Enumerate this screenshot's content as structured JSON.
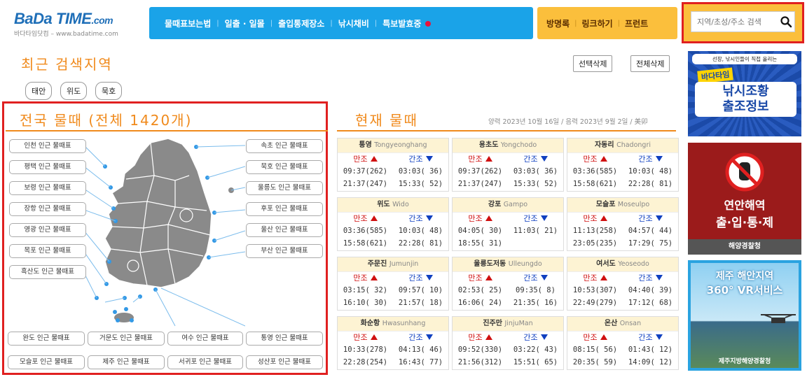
{
  "logo": {
    "brand_a": "BaDa",
    "brand_b": "TIME",
    "brand_c": ".com",
    "sub": "바다타임닷컴 – www.badatime.com"
  },
  "nav_main": [
    "물때표보는법",
    "일출 · 일몰",
    "출입통제장소",
    "낚시채비",
    "특보발효중"
  ],
  "nav_sub": [
    "방명록",
    "링크하기",
    "프런트"
  ],
  "search": {
    "placeholder": "지역/초성/주소 검색"
  },
  "recent": {
    "title": "최근 검색지역",
    "select_delete": "선택삭제",
    "delete_all": "전체삭제",
    "chips": [
      "태안",
      "위도",
      "묵호"
    ]
  },
  "national": {
    "title": "전국 물때 (전체 1420개)",
    "buttons": [
      "인천 인근 물때표",
      "평택 인근 물때표",
      "보령 인근 물때표",
      "장항 인근 물때표",
      "영광 인근 물때표",
      "목포 인근 물때표",
      "흑산도 인근 물때표",
      "속초 인근 물때표",
      "묵호 인근 물때표",
      "울릉도 인근 물때표",
      "후포 인근 물때표",
      "울산 인근 물때표",
      "부산 인근 물때표",
      "완도 인근 물때표",
      "거문도 인근 물때표",
      "여수 인근 물때표",
      "통영 인근 물때표",
      "모슬포 인근 물때표",
      "제주 인근 물때표",
      "서귀포 인근 물때표",
      "성산포 인근 물때표"
    ]
  },
  "current": {
    "title": "현재 물때",
    "date": "양력 2023년 10월 16일 / 음력 2023년 9월 2일 / 美卯",
    "high_label": "만조",
    "low_label": "간조",
    "cards": [
      {
        "name": "통영",
        "en": "Tongyeonghang",
        "h1": "09:37(262)",
        "h2": "21:37(247)",
        "l1": "03:03( 36)",
        "l2": "15:33( 52)"
      },
      {
        "name": "용초도",
        "en": "Yongchodo",
        "h1": "09:37(262)",
        "h2": "21:37(247)",
        "l1": "03:03( 36)",
        "l2": "15:33( 52)"
      },
      {
        "name": "자동리",
        "en": "Chadongri",
        "h1": "03:36(585)",
        "h2": "15:58(621)",
        "l1": "10:03( 48)",
        "l2": "22:28( 81)"
      },
      {
        "name": "위도",
        "en": "Wido",
        "h1": "03:36(585)",
        "h2": "15:58(621)",
        "l1": "10:03( 48)",
        "l2": "22:28( 81)"
      },
      {
        "name": "강포",
        "en": "Gampo",
        "h1": "04:05( 30)",
        "h2": "18:55( 31)",
        "l1": "11:03( 21)",
        "l2": ""
      },
      {
        "name": "모슬포",
        "en": "Moseulpo",
        "h1": "11:13(258)",
        "h2": "23:05(235)",
        "l1": "04:57( 44)",
        "l2": "17:29( 75)"
      },
      {
        "name": "주문진",
        "en": "Jumunjin",
        "h1": "03:15( 32)",
        "h2": "16:10( 30)",
        "l1": "09:57( 10)",
        "l2": "21:57( 18)"
      },
      {
        "name": "울릉도저동",
        "en": "Ulleungdo",
        "h1": "02:53( 25)",
        "h2": "16:06( 24)",
        "l1": "09:35( 8)",
        "l2": "21:35( 16)"
      },
      {
        "name": "여서도",
        "en": "Yeoseodo",
        "h1": "10:53(307)",
        "h2": "22:49(279)",
        "l1": "04:40( 39)",
        "l2": "17:12( 68)"
      },
      {
        "name": "화순항",
        "en": "Hwasunhang",
        "h1": "10:33(278)",
        "h2": "22:28(254)",
        "l1": "04:13( 46)",
        "l2": "16:43( 77)"
      },
      {
        "name": "진주만",
        "en": "JinjuMan",
        "h1": "09:52(330)",
        "h2": "21:56(312)",
        "l1": "03:22( 43)",
        "l2": "15:51( 65)"
      },
      {
        "name": "온산",
        "en": "Onsan",
        "h1": "08:15( 56)",
        "h2": "20:35( 59)",
        "l1": "01:43( 12)",
        "l2": "14:09( 12)"
      }
    ]
  },
  "ads": {
    "ad1": {
      "top": "선장, 낚시인들이 직접 올리는",
      "brand": "바다타임",
      "l1": "낚시조황",
      "l2": "출조정보"
    },
    "ad2": {
      "l1": "연안해역",
      "l2": "출·입·통·제",
      "foot": "해양경찰청"
    },
    "ad3": {
      "l1": "제주 해안지역",
      "l2": "360° VR서비스",
      "foot": "제주지방해양경찰청"
    }
  }
}
